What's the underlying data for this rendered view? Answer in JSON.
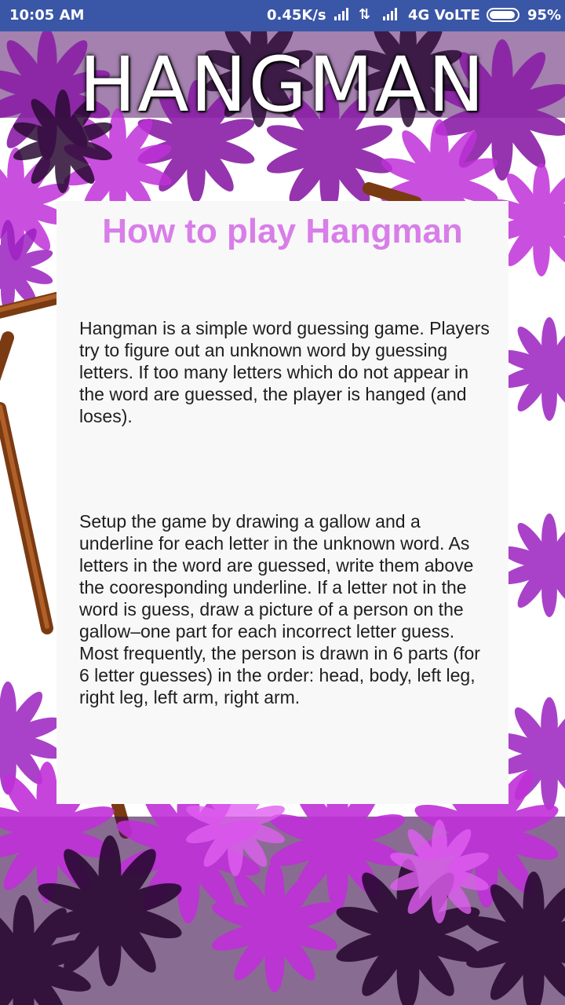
{
  "status_bar": {
    "time": "10:05 AM",
    "net_speed": "0.45K/s",
    "network": "4G VoLTE",
    "battery_percent": "95%",
    "battery_level": 0.95
  },
  "app": {
    "title": "HANGMAN"
  },
  "card": {
    "heading": "How to play Hangman",
    "paragraphs": [
      "Hangman is a simple word guessing game. Players try to figure out an unknown word by guessing letters. If too many letters which do not appear in the word are guessed, the player is hanged (and loses).",
      "Setup the game by drawing a gallow and a underline for each letter in the unknown word. As letters in the word are guessed, write them above the cooresponding underline. If a letter not in the word is guess, draw a picture of a person on the gallow–one part for each incorrect letter guess. Most frequently, the person is drawn in 6 parts (for 6 letter guesses) in the order: head, body, left leg, right leg, left arm, right arm."
    ]
  },
  "colors": {
    "status_bar": "#3a56a6",
    "heading": "#d87ee8",
    "card_bg": "#f8f8f8"
  }
}
